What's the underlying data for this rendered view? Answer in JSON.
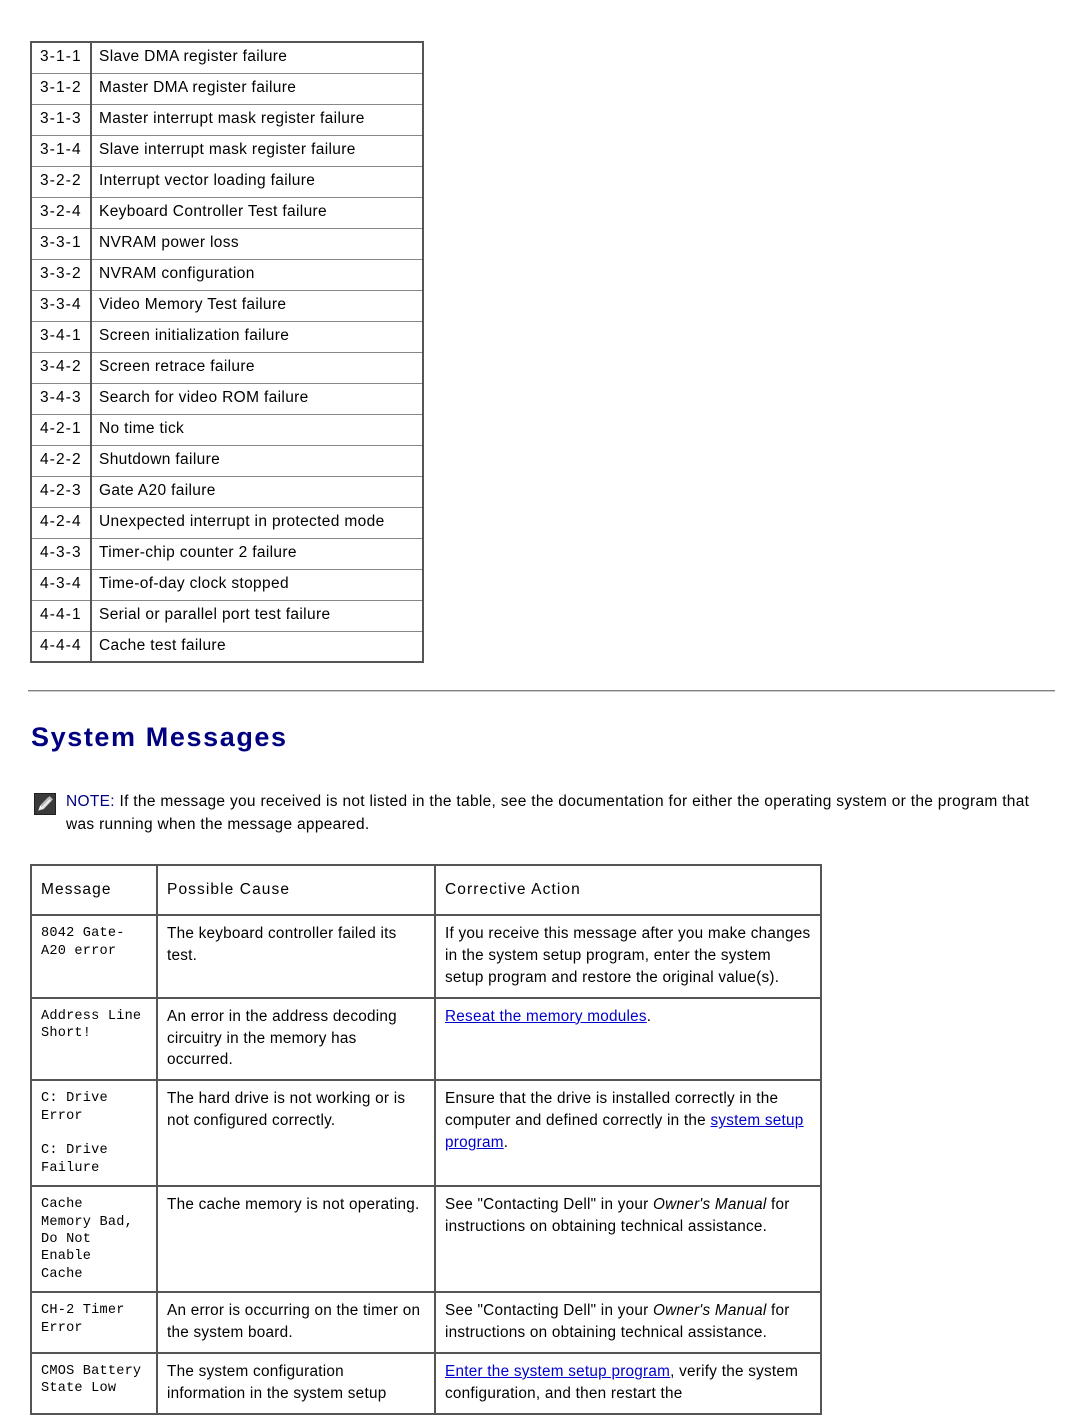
{
  "beep_table": {
    "name": "beep-code-table",
    "rows": [
      {
        "code": "3-1-1",
        "desc": "Slave DMA register failure"
      },
      {
        "code": "3-1-2",
        "desc": "Master DMA register failure"
      },
      {
        "code": "3-1-3",
        "desc": "Master interrupt mask register failure"
      },
      {
        "code": "3-1-4",
        "desc": "Slave interrupt mask register failure"
      },
      {
        "code": "3-2-2",
        "desc": "Interrupt vector loading failure"
      },
      {
        "code": "3-2-4",
        "desc": "Keyboard Controller Test failure"
      },
      {
        "code": "3-3-1",
        "desc": "NVRAM power loss"
      },
      {
        "code": "3-3-2",
        "desc": "NVRAM configuration"
      },
      {
        "code": "3-3-4",
        "desc": "Video Memory Test failure"
      },
      {
        "code": "3-4-1",
        "desc": "Screen initialization failure"
      },
      {
        "code": "3-4-2",
        "desc": "Screen retrace failure"
      },
      {
        "code": "3-4-3",
        "desc": "Search for video ROM failure"
      },
      {
        "code": "4-2-1",
        "desc": "No time tick"
      },
      {
        "code": "4-2-2",
        "desc": "Shutdown failure"
      },
      {
        "code": "4-2-3",
        "desc": "Gate A20 failure"
      },
      {
        "code": "4-2-4",
        "desc": "Unexpected interrupt in protected mode"
      },
      {
        "code": "4-3-3",
        "desc": "Timer-chip counter 2 failure"
      },
      {
        "code": "4-3-4",
        "desc": "Time-of-day clock stopped"
      },
      {
        "code": "4-4-1",
        "desc": "Serial or parallel port test failure"
      },
      {
        "code": "4-4-4",
        "desc": "Cache test failure"
      }
    ]
  },
  "section": {
    "heading": "System Messages"
  },
  "note": {
    "icon": "note-pencil-icon",
    "label": "NOTE:",
    "text": " If the message you received is not listed in the table, see the documentation for either the operating system or the program that was running when the message appeared."
  },
  "message_table": {
    "headers": {
      "message": "Message",
      "possible_cause": "Possible Cause",
      "corrective_action": "Corrective Action"
    },
    "rows": [
      {
        "message": "8042 Gate-\nA20 error",
        "cause": "The keyboard controller failed its test.",
        "action_plain": "If you receive this message after you make changes in the system setup program, enter the system setup program and restore the original value(s)."
      },
      {
        "message": "Address Line\nShort!",
        "cause": "An error in the address decoding circuitry in the memory has occurred.",
        "action_link": "Reseat the memory modules",
        "action_tail": "."
      },
      {
        "message": "C: Drive\nError\n\nC: Drive\nFailure",
        "cause": "The hard drive is not working or is not configured correctly.",
        "action_lead": "Ensure that the drive is installed correctly in the computer and defined correctly in the ",
        "action_link": "system setup program",
        "action_tail": "."
      },
      {
        "message": "Cache\nMemory Bad,\nDo Not\nEnable\nCache",
        "cause": "The cache memory is not operating.",
        "action_lead": "See \"Contacting Dell\" in your ",
        "action_italic": "Owner's Manual",
        "action_tail": " for instructions on obtaining technical assistance."
      },
      {
        "message": "CH-2 Timer\nError",
        "cause": "An error is occurring on the timer on the system board.",
        "action_lead": "See \"Contacting Dell\" in your ",
        "action_italic": "Owner's Manual",
        "action_tail": " for instructions on obtaining technical assistance."
      },
      {
        "message": "CMOS Battery\nState Low",
        "cause": "The system configuration information in the system setup",
        "action_link": "Enter the system setup program",
        "action_tail": ", verify the system configuration, and then restart the"
      }
    ]
  },
  "colors": {
    "heading": "#000080",
    "link": "#0000CC",
    "note_label": "#000080",
    "text": "#000000",
    "table_border": "#555555",
    "rule": "#808080"
  }
}
